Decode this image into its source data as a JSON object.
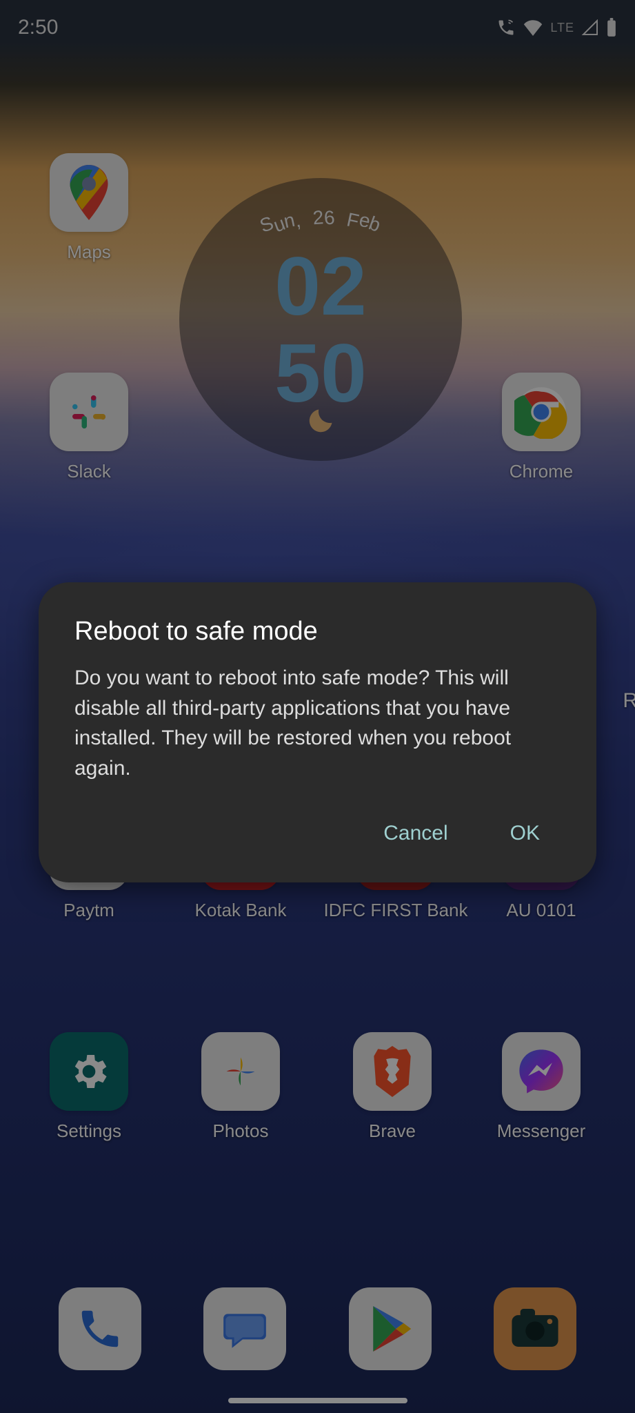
{
  "statusBar": {
    "time": "2:50",
    "networkLabel": "LTE"
  },
  "clockWidget": {
    "date": "Sun, 26 Feb",
    "hour": "02",
    "minute": "50"
  },
  "apps": {
    "maps": "Maps",
    "slack": "Slack",
    "chrome": "Chrome",
    "paytm": "Paytm",
    "kotak": "Kotak Bank",
    "idfc": "IDFC FIRST Bank",
    "au": "AU 0101",
    "settings": "Settings",
    "photos": "Photos",
    "brave": "Brave",
    "messenger": "Messenger"
  },
  "edge": {
    "partial": "R"
  },
  "dialog": {
    "title": "Reboot to safe mode",
    "body": "Do you want to reboot into safe mode? This will disable all third-party applications that you have installed. They will be restored when you reboot again.",
    "cancel": "Cancel",
    "ok": "OK"
  }
}
